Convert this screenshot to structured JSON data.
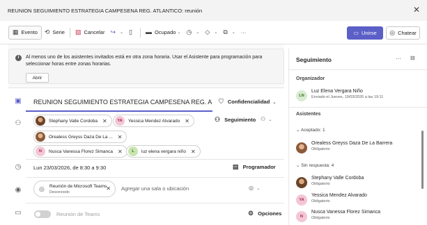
{
  "window": {
    "title": "REUNION SEGUIMIENTO ESTRATEGIA CAMPESENA REG. ATLANTICO: reunión",
    "close_glyph": "✕"
  },
  "toolbar": {
    "evento": "Evento",
    "serie": "Serie",
    "cancelar": "Cancelar",
    "ocupado": "Ocupado",
    "more": "···",
    "unirse": "Unirse",
    "chatear": "Chatear"
  },
  "banner": {
    "message": "Al menos uno de los asistentes invitados está en otra zona horaria. Usar el Asistente para programación para seleccionar horas entre zonas horarias.",
    "button": "Abrir"
  },
  "meeting": {
    "title": "REUNION SEGUIMIENTO ESTRATEGIA CAMPESENA REG. ATLANTI",
    "confidencialidad": "Confidencialidad",
    "seguimiento": "Seguimiento",
    "attendees": [
      {
        "name": "Stephany Valle Cordoba",
        "initials": ""
      },
      {
        "name": "Yessica Mendez Alvarado",
        "initials": "YA"
      },
      {
        "name": "Orealess Greyss Daza De La ...",
        "initials": ""
      },
      {
        "name": "Nusca Vanessa Florez Simanca",
        "initials": "N"
      },
      {
        "name": "luz elena vergara niño",
        "initials": "L"
      }
    ],
    "date": "Lun 23/03/2026, de 8:30 a 9:30",
    "programador": "Programador",
    "location_chip_title": "Reunión de Microsoft Teams",
    "location_chip_sub": "Desconocido",
    "location_placeholder": "Agregar una sala o ubicación",
    "teams_label": "Reunión de Teams",
    "opciones": "Opciones"
  },
  "tracking": {
    "title": "Seguimiento",
    "more": "···",
    "organizer_label": "Organizador",
    "organizer": {
      "name": "Luz Elena Vergara Niño",
      "initials": "LN",
      "sub": "Enviado el Jueves, 19/03/2026 a las 19:11"
    },
    "attendees_label": "Asistentes",
    "accepted_label": "Aceptado: 1",
    "accepted": [
      {
        "name": "Orealess Greyss Daza De La Barrera",
        "sub": "Obligatorio"
      }
    ],
    "no_response_label": "Sin respuesta: 4",
    "no_response": [
      {
        "name": "Stephany Valle Cordoba",
        "sub": "Obligatorio",
        "initials": ""
      },
      {
        "name": "Yessica Mendez Alvarado",
        "sub": "Obligatorio",
        "initials": "YA"
      },
      {
        "name": "Nusca Vanessa Florez Simanca",
        "sub": "Obligatorio",
        "initials": "N"
      }
    ]
  },
  "colors": {
    "accent": "#5b5fc7",
    "cancel_icon": "#c4314b"
  }
}
